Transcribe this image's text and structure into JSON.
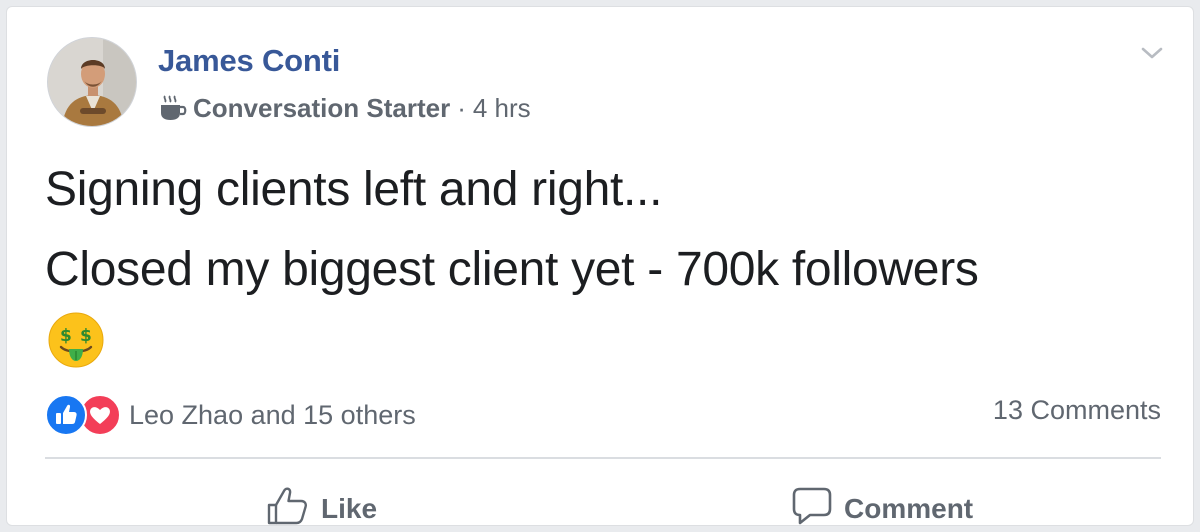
{
  "post": {
    "author": {
      "name": "James Conti",
      "avatar_icon": "profile-photo"
    },
    "badge": {
      "icon": "coffee-cup-icon",
      "label": "Conversation Starter"
    },
    "separator": "·",
    "timestamp": "4 hrs",
    "menu_icon": "chevron-down-icon",
    "text_lines": [
      "Signing clients left and right...",
      "Closed my biggest client yet - 700k followers"
    ],
    "emoji": "money-mouth-face-emoji"
  },
  "engagement": {
    "reaction_icons": [
      "like-reaction-icon",
      "love-reaction-icon"
    ],
    "reactors_text": "Leo Zhao and 15 others",
    "comments_text": "13 Comments"
  },
  "actions": {
    "like": {
      "icon": "thumbs-up-icon",
      "label": "Like"
    },
    "comment": {
      "icon": "speech-bubble-icon",
      "label": "Comment"
    }
  },
  "colors": {
    "author_link": "#385898",
    "secondary_text": "#606770",
    "primary_text": "#1c1e21",
    "like_blue": "#1877f2",
    "love_red": "#f33e58",
    "background": "#e9ebee"
  }
}
